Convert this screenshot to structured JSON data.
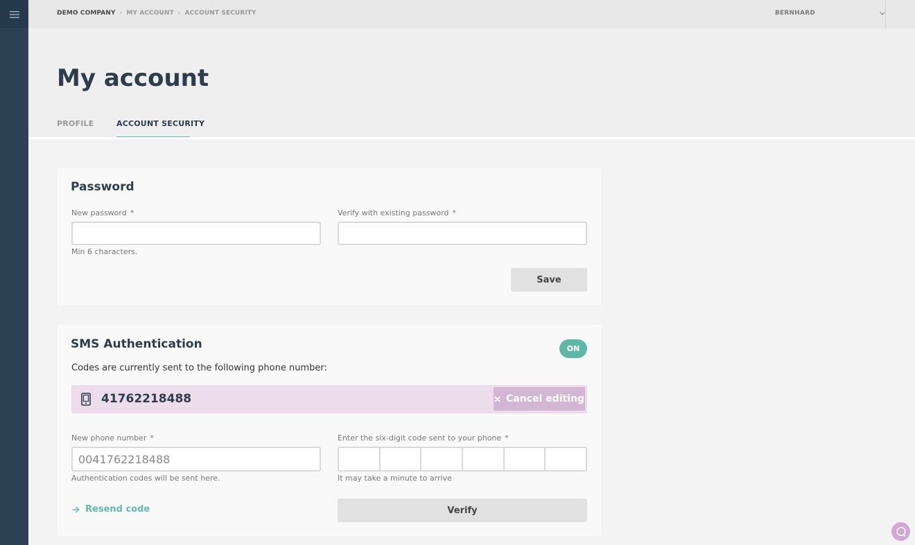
{
  "breadcrumb": {
    "items": [
      "DEMO COMPANY",
      "MY ACCOUNT",
      "ACCOUNT SECURITY"
    ]
  },
  "user": {
    "name": "BERNHARD"
  },
  "page": {
    "title": "My account"
  },
  "tabs": [
    {
      "label": "PROFILE",
      "active": false
    },
    {
      "label": "ACCOUNT SECURITY",
      "active": true
    }
  ],
  "password": {
    "title": "Password",
    "new_label": "New password",
    "verify_label": "Verify with existing password",
    "required_mark": "*",
    "hint": "Min 6 characters.",
    "save_label": "Save"
  },
  "sms": {
    "title": "SMS Authentication",
    "status": "ON",
    "description": "Codes are currently sent to the following phone number:",
    "current_phone": "41762218488",
    "cancel_label": "Cancel editing",
    "new_phone_label": "New phone number",
    "new_phone_placeholder": "0041762218488",
    "new_phone_hint": "Authentication codes will be sent here.",
    "code_label": "Enter the six-digit code sent to your phone",
    "code_hint": "It may take a minute to arrive",
    "required_mark": "*",
    "resend_label": "Resend code",
    "verify_label": "Verify"
  },
  "colors": {
    "sidebar": "#2e4256",
    "accent": "#67b8aa",
    "toggle_on": "#5fb8a6",
    "phone_bar": "#ecdcec",
    "cancel_button": "#d3b6d3"
  },
  "icons": {
    "menu": "hamburger-menu-icon",
    "chevron": "chevron-down-icon",
    "phone": "mobile-phone-icon",
    "close": "close-icon",
    "arrow": "arrow-right-icon",
    "chat": "chat-icon"
  }
}
